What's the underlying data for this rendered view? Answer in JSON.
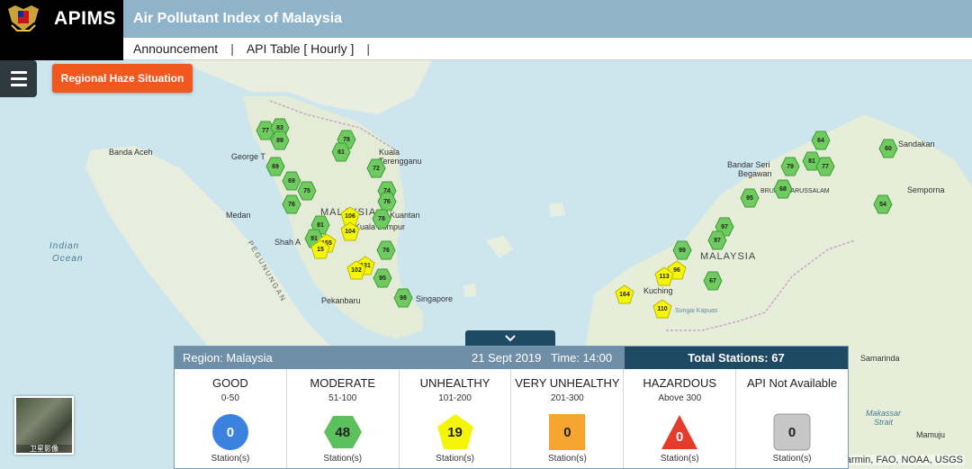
{
  "header": {
    "brand": "APIMS",
    "title": "Air Pollutant Index of Malaysia",
    "nav": [
      "Announcement",
      "API Table [ Hourly ]"
    ]
  },
  "controls": {
    "haze_button": "Regional Haze Situation",
    "basemap_label": "卫星影像"
  },
  "attribution": "Garmin, FAO, NOAA, USGS",
  "map": {
    "places": [
      {
        "name": "Banda Aceh"
      },
      {
        "name": "George T"
      },
      {
        "name": "Kuala"
      },
      {
        "name": "Terengganu"
      },
      {
        "name": "Medan"
      },
      {
        "name": "MALAYSIA"
      },
      {
        "name": "Kuantan"
      },
      {
        "name": "Shah A"
      },
      {
        "name": "Kuala Lumpur"
      },
      {
        "name": "Singapore"
      },
      {
        "name": "Pekanbaru"
      },
      {
        "name": "Bandar Seri"
      },
      {
        "name": "Begawan"
      },
      {
        "name": "BRUNEI DARUSSALAM"
      },
      {
        "name": "Sandakan"
      },
      {
        "name": "Semporna"
      },
      {
        "name": "MALAYSIA"
      },
      {
        "name": "Kuching"
      },
      {
        "name": "Samarinda"
      },
      {
        "name": "Makassar"
      },
      {
        "name": "Strait"
      },
      {
        "name": "Mamuju"
      },
      {
        "name": "Sungai Kapuas"
      },
      {
        "name": "Indian"
      },
      {
        "name": "Ocean"
      },
      {
        "name": "PEGUNUNGAN"
      }
    ],
    "stations": [
      {
        "v": "77",
        "l": "moderate"
      },
      {
        "v": "83",
        "l": "moderate"
      },
      {
        "v": "89",
        "l": "moderate"
      },
      {
        "v": "78",
        "l": "moderate"
      },
      {
        "v": "61",
        "l": "moderate"
      },
      {
        "v": "69",
        "l": "moderate"
      },
      {
        "v": "72",
        "l": "moderate"
      },
      {
        "v": "69",
        "l": "moderate"
      },
      {
        "v": "75",
        "l": "moderate"
      },
      {
        "v": "76",
        "l": "moderate"
      },
      {
        "v": "74",
        "l": "moderate"
      },
      {
        "v": "76",
        "l": "moderate"
      },
      {
        "v": "81",
        "l": "moderate"
      },
      {
        "v": "78",
        "l": "moderate"
      },
      {
        "v": "91",
        "l": "moderate"
      },
      {
        "v": "106",
        "l": "unhealthy"
      },
      {
        "v": "104",
        "l": "unhealthy"
      },
      {
        "v": "155",
        "l": "unhealthy"
      },
      {
        "v": "15",
        "l": "unhealthy"
      },
      {
        "v": "76",
        "l": "moderate"
      },
      {
        "v": "131",
        "l": "unhealthy"
      },
      {
        "v": "102",
        "l": "unhealthy"
      },
      {
        "v": "95",
        "l": "moderate"
      },
      {
        "v": "98",
        "l": "moderate"
      },
      {
        "v": "64",
        "l": "moderate"
      },
      {
        "v": "60",
        "l": "moderate"
      },
      {
        "v": "79",
        "l": "moderate"
      },
      {
        "v": "81",
        "l": "moderate"
      },
      {
        "v": "77",
        "l": "moderate"
      },
      {
        "v": "68",
        "l": "moderate"
      },
      {
        "v": "95",
        "l": "moderate"
      },
      {
        "v": "54",
        "l": "moderate"
      },
      {
        "v": "97",
        "l": "moderate"
      },
      {
        "v": "97",
        "l": "moderate"
      },
      {
        "v": "99",
        "l": "moderate"
      },
      {
        "v": "96",
        "l": "unhealthy"
      },
      {
        "v": "113",
        "l": "unhealthy"
      },
      {
        "v": "67",
        "l": "moderate"
      },
      {
        "v": "164",
        "l": "unhealthy"
      },
      {
        "v": "110",
        "l": "unhealthy"
      }
    ]
  },
  "panel": {
    "region": "Region: Malaysia",
    "datetime": "21 Sept 2019   Time: 14:00",
    "total": "Total Stations: 67",
    "categories": [
      {
        "name": "GOOD",
        "range": "0-50",
        "count": "0",
        "unit": "Station(s)",
        "color": "#3b82e0",
        "shape": "circle"
      },
      {
        "name": "MODERATE",
        "range": "51-100",
        "count": "48",
        "unit": "Station(s)",
        "color": "#5cc15c",
        "shape": "hexagon"
      },
      {
        "name": "UNHEALTHY",
        "range": "101-200",
        "count": "19",
        "unit": "Station(s)",
        "color": "#f5f50a",
        "shape": "pentagon"
      },
      {
        "name": "VERY UNHEALTHY",
        "range": "201-300",
        "count": "0",
        "unit": "Station(s)",
        "color": "#f7a531",
        "shape": "square"
      },
      {
        "name": "HAZARDOUS",
        "range": "Above 300",
        "count": "0",
        "unit": "Station(s)",
        "color": "#e53b2b",
        "shape": "triangle"
      },
      {
        "name": "API Not Available",
        "range": "",
        "count": "0",
        "unit": "Station(s)",
        "color": "#c7c7c7",
        "shape": "rounded"
      }
    ]
  }
}
